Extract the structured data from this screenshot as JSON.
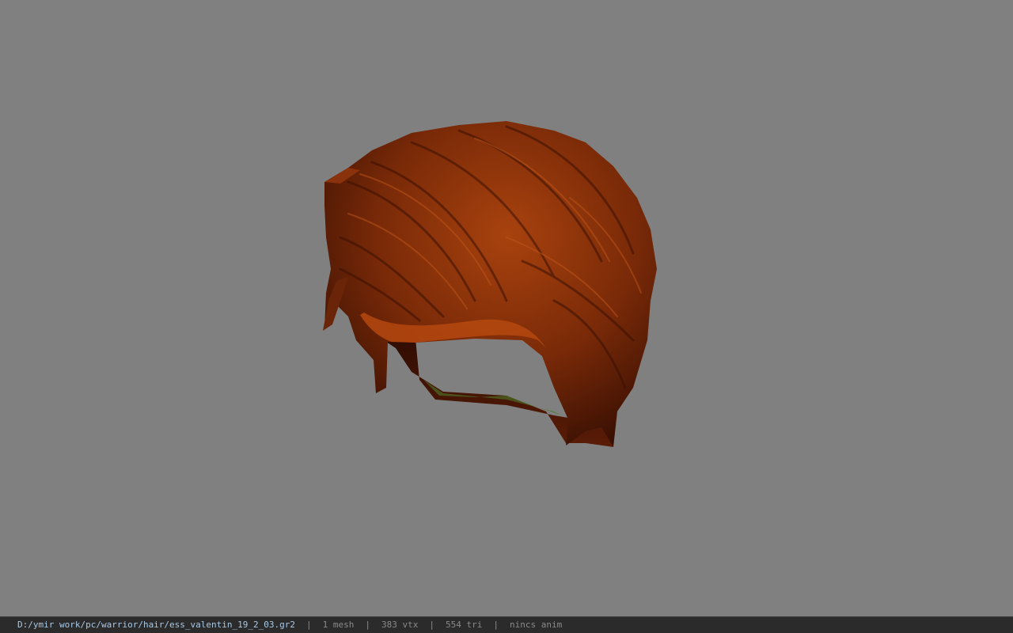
{
  "viewer": {
    "background_color": "#808080",
    "model_name": "hair-mesh",
    "model_colors": {
      "base": "#7a2a08",
      "highlight": "#b5480f",
      "shadow": "#3a1003",
      "inner": "#4a1606",
      "under_tint": "#4f7a2a"
    }
  },
  "status_bar": {
    "file_path": "D:/ymir work/pc/warrior/hair/ess_valentin_19_2_03.gr2",
    "separator": "|",
    "mesh_count": "1 mesh",
    "vertex_count": "383 vtx",
    "triangle_count": "554 tri",
    "anim": "nincs anim"
  }
}
